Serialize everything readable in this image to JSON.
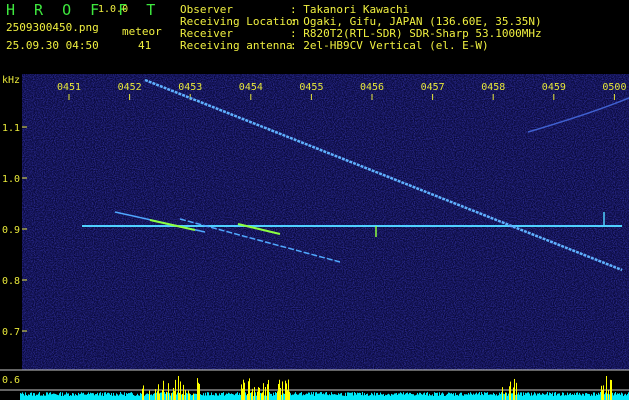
{
  "header": {
    "app_title": "H R O F F T",
    "app_version": "1.0.0",
    "filename": "2509300450.png",
    "meteor_label": "meteor",
    "timestamp": "25.09.30 04:50",
    "meteor_count": "41",
    "info": [
      {
        "label": "Observer",
        "value": ": Takanori Kawachi"
      },
      {
        "label": "Receiving Location",
        "value": ": Ogaki, Gifu, JAPAN (136.60E, 35.35N)"
      },
      {
        "label": "Receiver",
        "value": ": R820T2(RTL-SDR) SDR-Sharp 53.1000MHz"
      },
      {
        "label": "Receiving antenna",
        "value": ": 2el-HB9CV Vertical (el. E-W)"
      }
    ]
  },
  "spectrogram": {
    "y_unit": "kHz",
    "time_ticks": [
      "0451",
      "0452",
      "0453",
      "0454",
      "0455",
      "0456",
      "0457",
      "0458",
      "0459",
      "0500"
    ],
    "freq_ticks": [
      "1.1",
      "1.0",
      "0.9",
      "0.8",
      "0.7"
    ],
    "lower_tick": "0.6",
    "colors": {
      "background": "#0a0a3c",
      "carrier": "#4fd0ff",
      "trace": "#5fb0ff",
      "meteor_green": "#8cff40",
      "power_cyan": "#00e8f8",
      "power_yellow": "#ffff00",
      "tick_text": "#e8e83a"
    }
  }
}
